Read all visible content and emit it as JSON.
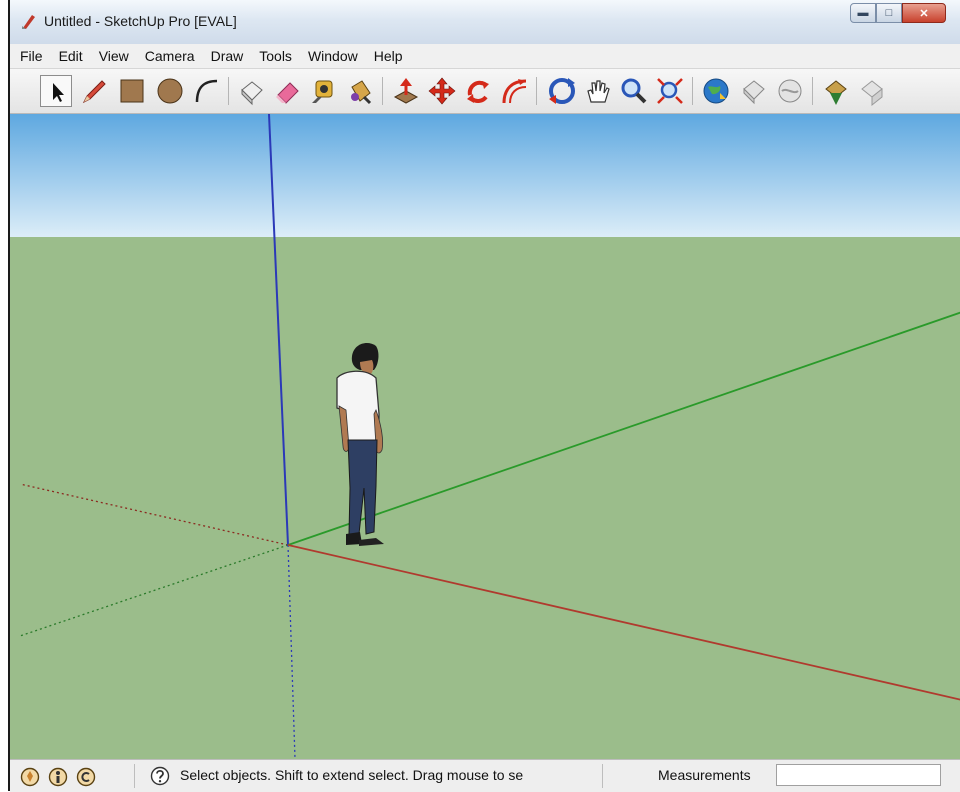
{
  "window": {
    "title": "Untitled - SketchUp Pro [EVAL]",
    "controls": {
      "minimize_icon": "minimize-icon",
      "maximize_icon": "maximize-icon",
      "close_icon": "close-icon"
    }
  },
  "menu": {
    "items": [
      "File",
      "Edit",
      "View",
      "Camera",
      "Draw",
      "Tools",
      "Window",
      "Help"
    ]
  },
  "toolbar": {
    "active_tool": "select-tool",
    "tools": [
      "select",
      "line",
      "rectangle",
      "circle",
      "arc",
      "make-component",
      "eraser",
      "tape-measure",
      "paint-bucket",
      "push-pull",
      "move",
      "rotate",
      "offset",
      "orbit",
      "pan",
      "zoom",
      "zoom-extents",
      "get-models",
      "share-model",
      "share-component",
      "preview-in-google-earth",
      "get-current-view"
    ]
  },
  "viewport": {
    "colors": {
      "sky_top": "#5ea8e0",
      "sky_bottom": "#dcedf8",
      "ground": "#9bbd8b",
      "red_axis": "#b03a2e",
      "green_axis": "#2a9a2a",
      "blue_axis": "#2b39b8"
    },
    "figure": "person-figure"
  },
  "status": {
    "icons": [
      "geo-location-icon",
      "credits-icon",
      "user-icon"
    ],
    "hint": "Select objects. Shift to extend select. Drag mouse to se",
    "measurements_label": "Measurements",
    "measurements_value": ""
  }
}
